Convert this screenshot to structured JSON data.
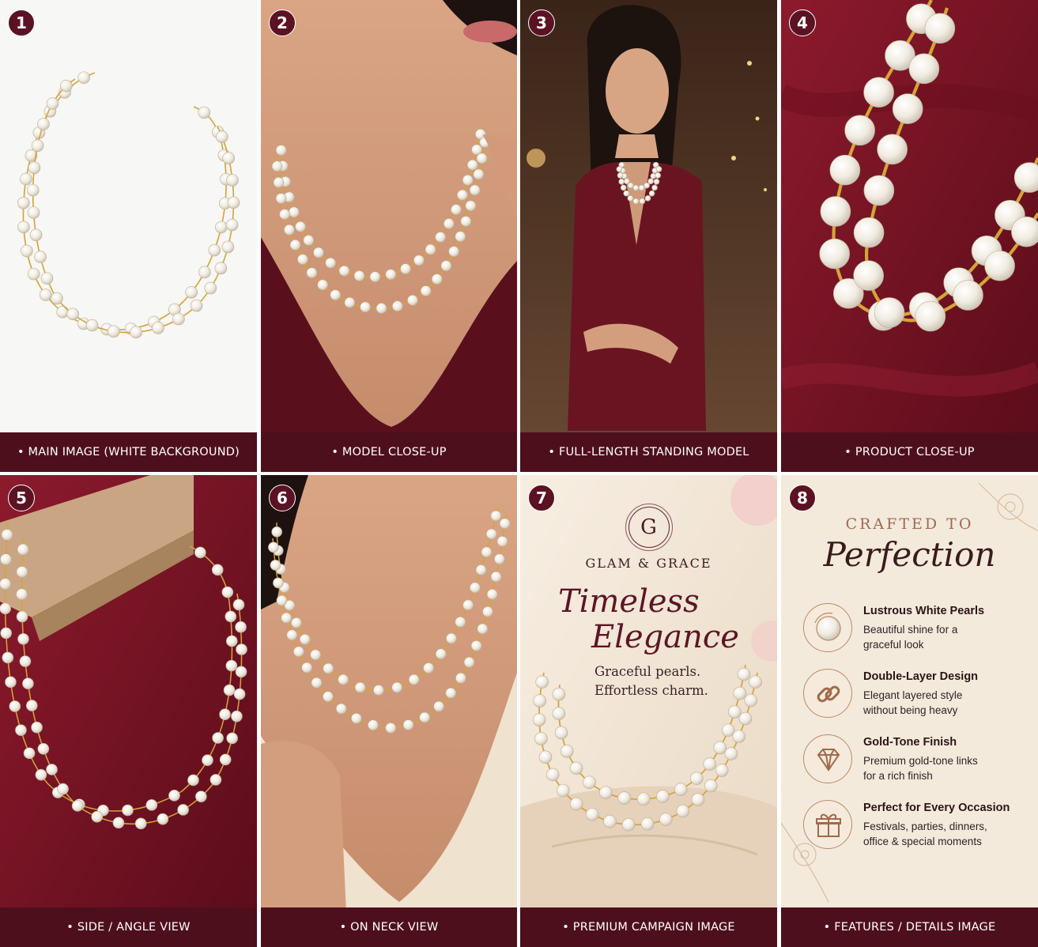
{
  "panels": [
    {
      "number": "1",
      "caption": "• MAIN IMAGE (WHITE BACKGROUND)"
    },
    {
      "number": "2",
      "caption": "• MODEL CLOSE-UP"
    },
    {
      "number": "3",
      "caption": "• FULL-LENGTH STANDING MODEL"
    },
    {
      "number": "4",
      "caption": "• PRODUCT CLOSE-UP"
    },
    {
      "number": "5",
      "caption": "• SIDE / ANGLE VIEW"
    },
    {
      "number": "6",
      "caption": "• ON NECK VIEW"
    },
    {
      "number": "7",
      "caption": "• PREMIUM CAMPAIGN IMAGE"
    },
    {
      "number": "8",
      "caption": "• FEATURES / DETAILS IMAGE"
    }
  ],
  "campaign": {
    "monogram": "G",
    "brand": "GLAM & GRACE",
    "headline_line1": "Timeless",
    "headline_line2": "Elegance",
    "tagline_line1": "Graceful pearls.",
    "tagline_line2": "Effortless charm."
  },
  "features": {
    "eyebrow": "CRAFTED TO",
    "title": "Perfection",
    "items": [
      {
        "icon": "pearl-icon",
        "title": "Lustrous White Pearls",
        "desc_line1": "Beautiful shine for a",
        "desc_line2": "graceful look"
      },
      {
        "icon": "chain-link-icon",
        "title": "Double-Layer Design",
        "desc_line1": "Elegant layered style",
        "desc_line2": "without being heavy"
      },
      {
        "icon": "diamond-icon",
        "title": "Gold-Tone Finish",
        "desc_line1": "Premium gold-tone links",
        "desc_line2": "for a rich finish"
      },
      {
        "icon": "gift-icon",
        "title": "Perfect for Every Occasion",
        "desc_line1": "Festivals, parties, dinners,",
        "desc_line2": "office & special moments"
      }
    ]
  },
  "colors": {
    "maroon": "#4e0f1d",
    "wine_fabric": "#7a1426",
    "gold": "#d4a53a",
    "pearl": "#f6f1e6",
    "cream": "#f3e7d8"
  }
}
